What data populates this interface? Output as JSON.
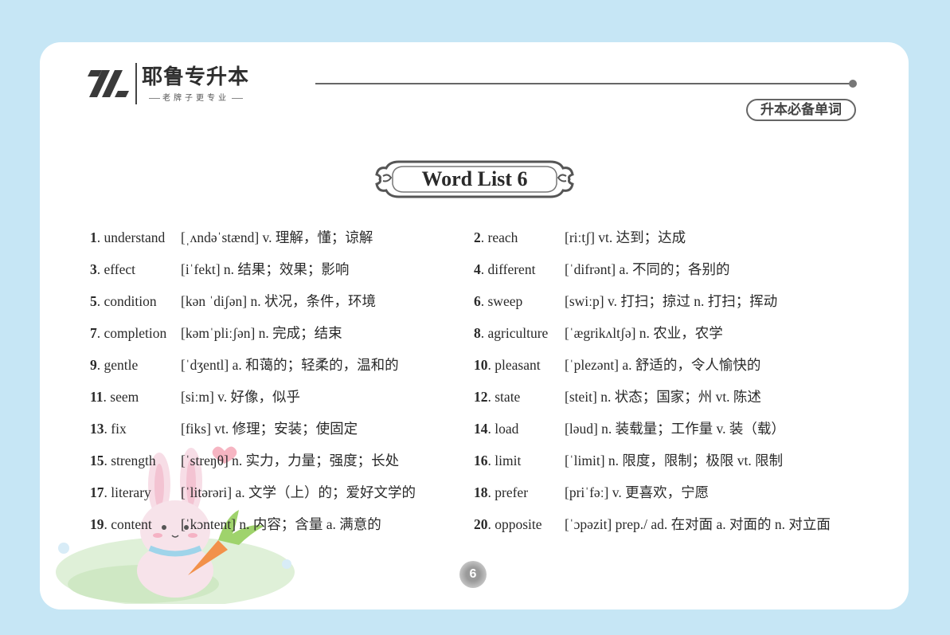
{
  "brand": {
    "name": "耶鲁专升本",
    "tagline": "老牌子更专业"
  },
  "badge": "升本必备单词",
  "title": "Word List 6",
  "words": [
    {
      "num": "1",
      "word": "understand",
      "def": "[ˌʌndəˈstænd]  v. 理解，懂；谅解"
    },
    {
      "num": "2",
      "word": "reach",
      "def": "[riːtʃ]  vt. 达到；达成"
    },
    {
      "num": "3",
      "word": "effect",
      "def": "[iˈfekt]  n. 结果；效果；影响"
    },
    {
      "num": "4",
      "word": "different",
      "def": "[ˈdifrənt]  a. 不同的；各别的"
    },
    {
      "num": "5",
      "word": "condition",
      "def": "[kən ˈdiʃən]  n. 状况，条件，环境"
    },
    {
      "num": "6",
      "word": "sweep",
      "def": "[swiːp]  v. 打扫；掠过  n. 打扫；挥动"
    },
    {
      "num": "7",
      "word": "completion",
      "def": "[kəmˈpliːʃən]  n. 完成；结束"
    },
    {
      "num": "8",
      "word": "agriculture",
      "def": "[ˈægrikʌltʃə]  n. 农业，农学"
    },
    {
      "num": "9",
      "word": "gentle",
      "def": "[ˈdʒentl]  a. 和蔼的；轻柔的，温和的"
    },
    {
      "num": "10",
      "word": "pleasant",
      "def": "[ˈplezənt]  a. 舒适的，令人愉快的"
    },
    {
      "num": "11",
      "word": "seem",
      "def": "[siːm]  v. 好像，似乎"
    },
    {
      "num": "12",
      "word": "state",
      "def": "[steit]  n. 状态；国家；州  vt. 陈述"
    },
    {
      "num": "13",
      "word": "fix",
      "def": "[fiks]  vt. 修理；安装；使固定"
    },
    {
      "num": "14",
      "word": "load",
      "def": "[ləud]  n. 装载量；工作量  v. 装（载）"
    },
    {
      "num": "15",
      "word": "strength",
      "def": "[ˈstreŋθ]  n. 实力，力量；强度；长处"
    },
    {
      "num": "16",
      "word": "limit",
      "def": "[ˈlimit]  n. 限度，限制；极限  vt. 限制"
    },
    {
      "num": "17",
      "word": "literary",
      "def": "[ˈlitərəri]  a. 文学（上）的；爱好文学的"
    },
    {
      "num": "18",
      "word": "prefer",
      "def": "[priˈfəː]  v. 更喜欢，宁愿"
    },
    {
      "num": "19",
      "word": "content",
      "def": "[ˈkɔntent]  n. 内容；含量  a. 满意的"
    },
    {
      "num": "20",
      "word": "opposite",
      "def": "[ˈɔpəzit]  prep./ ad. 在对面  a. 对面的  n. 对立面"
    }
  ],
  "page_number": "6"
}
